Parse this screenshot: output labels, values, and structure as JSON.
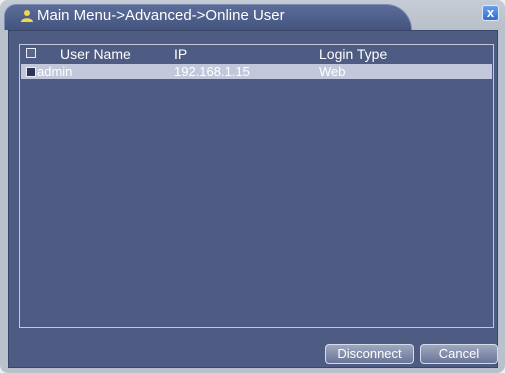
{
  "window": {
    "title": "Main Menu->Advanced->Online User",
    "title_icon": "user-icon",
    "close_label": "x"
  },
  "table": {
    "columns": {
      "user_name": "User Name",
      "ip": "IP",
      "login_type": "Login Type"
    },
    "rows": [
      {
        "user_name": "admin",
        "ip": "192.168.1.15",
        "login_type": "Web",
        "selected": true
      }
    ]
  },
  "buttons": {
    "disconnect": "Disconnect",
    "cancel": "Cancel"
  },
  "colors": {
    "panel": "#4e5b82",
    "selected_row": "#c3c7dc",
    "titlebar": "#b9c1cc"
  }
}
